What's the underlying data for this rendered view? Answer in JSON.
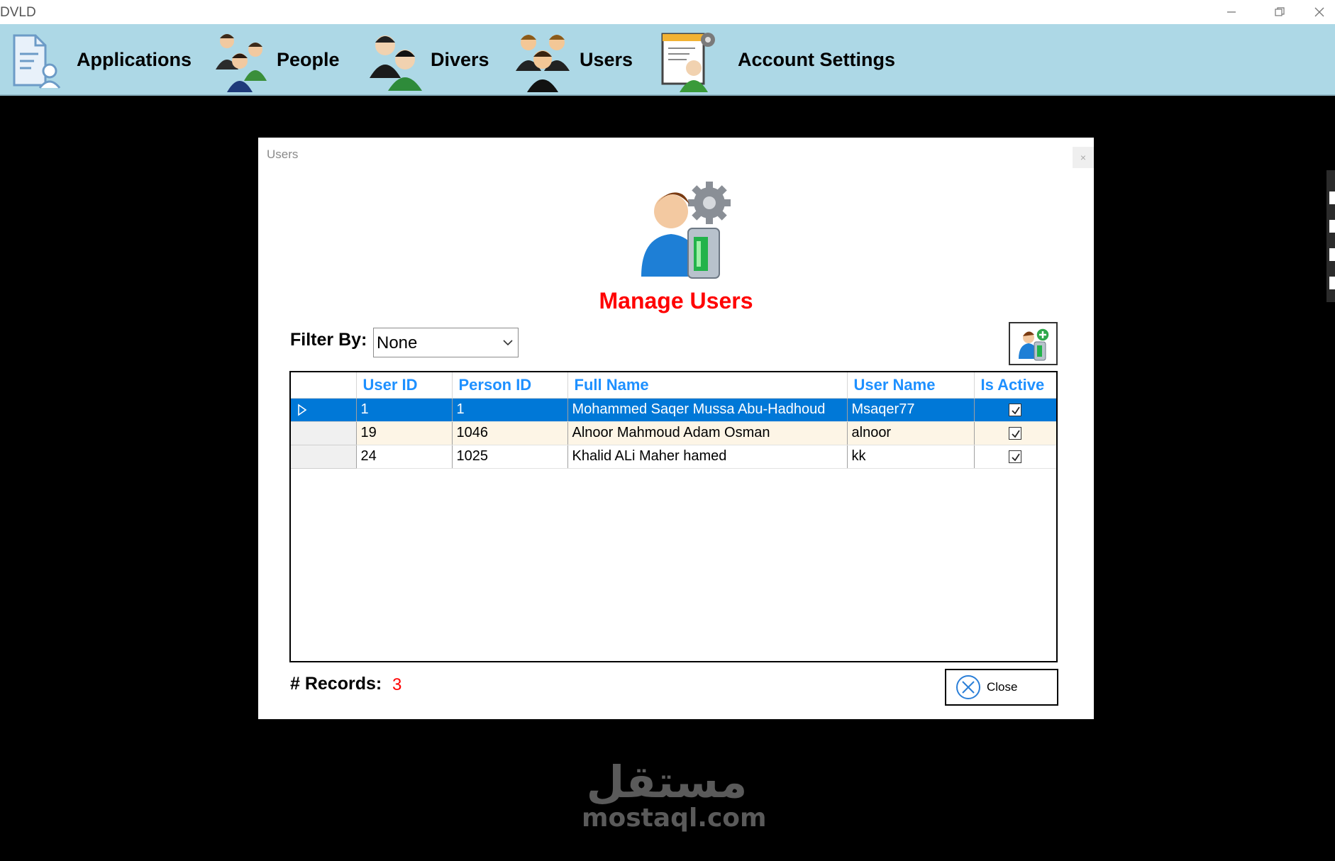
{
  "window": {
    "title": "DVLD",
    "minimize_icon": "minimize-icon",
    "restore_icon": "restore-icon",
    "close_icon": "close-icon"
  },
  "menu": {
    "items": [
      {
        "label": "Applications",
        "icon": "applications-icon"
      },
      {
        "label": "People",
        "icon": "people-icon"
      },
      {
        "label": "Divers",
        "icon": "drivers-icon"
      },
      {
        "label": "Users",
        "icon": "users-icon"
      },
      {
        "label": "Account Settings",
        "icon": "account-settings-icon"
      }
    ]
  },
  "dialog": {
    "title": "Users",
    "close_glyph": "×",
    "heading": "Manage Users",
    "filter": {
      "label": "Filter By:",
      "value": "None"
    },
    "add_user_icon": "add-user-icon",
    "grid": {
      "columns": [
        "User ID",
        "Person ID",
        "Full Name",
        "User Name",
        "Is Active"
      ],
      "rows": [
        {
          "user_id": "1",
          "person_id": "1",
          "full_name": "Mohammed Saqer Mussa Abu-Hadhoud",
          "user_name": "Msaqer77",
          "is_active": true,
          "selected": true
        },
        {
          "user_id": "19",
          "person_id": "1046",
          "full_name": "Alnoor Mahmoud Adam Osman",
          "user_name": "alnoor",
          "is_active": true,
          "selected": false
        },
        {
          "user_id": "24",
          "person_id": "1025",
          "full_name": "Khalid ALi Maher hamed",
          "user_name": "kk",
          "is_active": true,
          "selected": false
        }
      ]
    },
    "records": {
      "label": "# Records:",
      "count": "3"
    },
    "close_button": {
      "label": "Close"
    }
  },
  "watermark": {
    "arabic": "مستقل",
    "latin": "mostaql.com"
  },
  "colors": {
    "menu_bg": "#add8e6",
    "heading": "#ff0000",
    "column_header": "#1e90ff",
    "selection": "#0078d7",
    "alt_row": "#fdf5e6"
  }
}
